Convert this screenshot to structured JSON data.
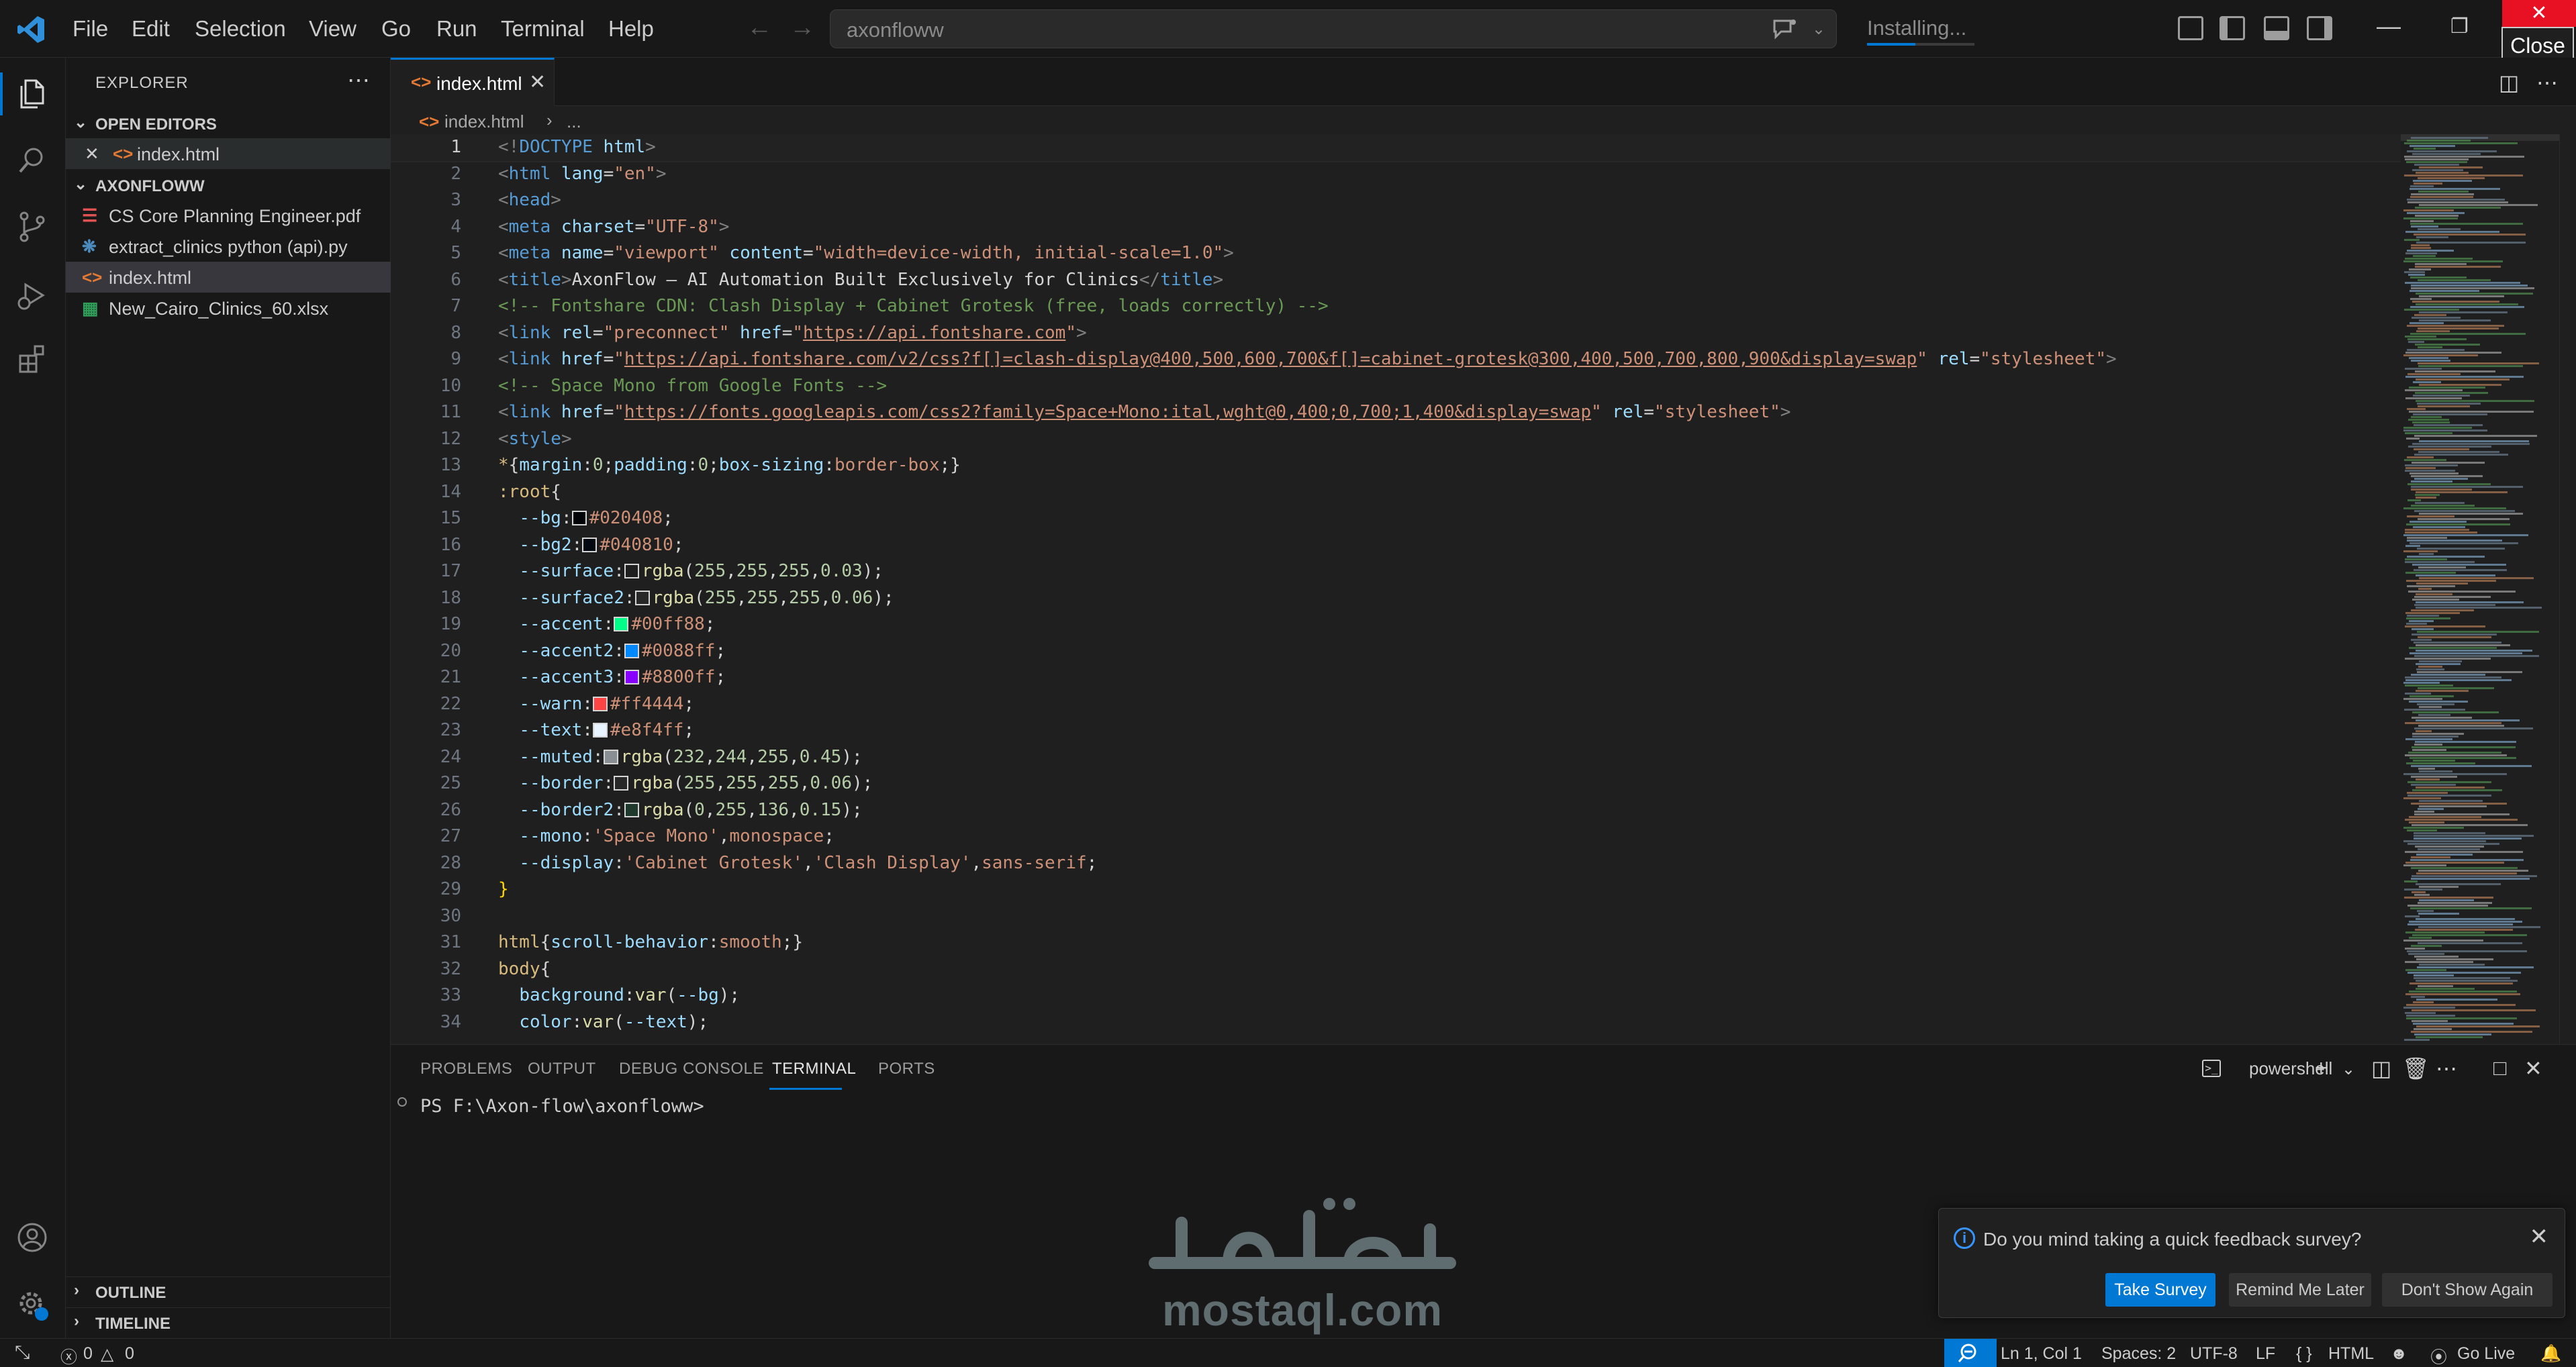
{
  "titlebar": {
    "menu": [
      "File",
      "Edit",
      "Selection",
      "View",
      "Go",
      "Run",
      "Terminal",
      "Help"
    ],
    "search_text": "axonfloww",
    "status_text": "Installing...",
    "install_progress": 0.45,
    "close_tooltip": "Close"
  },
  "sidebar": {
    "title": "EXPLORER",
    "open_editors_label": "OPEN EDITORS",
    "open_editors": [
      {
        "name": "index.html",
        "icon": "html-file-icon"
      }
    ],
    "folder_label": "AXONFLOWW",
    "files": [
      {
        "name": "CS Core Planning Engineer.pdf",
        "icon": "pdf-file-icon"
      },
      {
        "name": "extract_clinics python (api).py",
        "icon": "python-file-icon"
      },
      {
        "name": "index.html",
        "icon": "html-file-icon"
      },
      {
        "name": "New_Cairo_Clinics_60.xlsx",
        "icon": "excel-file-icon"
      }
    ],
    "outline_label": "OUTLINE",
    "timeline_label": "TIMELINE"
  },
  "editor": {
    "tab_label": "index.html",
    "breadcrumb": {
      "file": "index.html",
      "more": "..."
    },
    "current_line": 1,
    "line_numbers": [
      "1",
      "2",
      "3",
      "4",
      "5",
      "6",
      "7",
      "8",
      "9",
      "10",
      "11",
      "12",
      "13",
      "14",
      "15",
      "16",
      "17",
      "18",
      "19",
      "20",
      "21",
      "22",
      "23",
      "24",
      "25",
      "26",
      "27",
      "28",
      "29",
      "30",
      "31",
      "32",
      "33",
      "34"
    ],
    "lines": [
      [
        [
          "tag",
          "<!"
        ],
        [
          "el",
          "DOCTYPE"
        ],
        [
          "at",
          " html"
        ],
        [
          "tag",
          ">"
        ]
      ],
      [
        [
          "tag",
          "<"
        ],
        [
          "el",
          "html"
        ],
        [
          "at",
          " lang"
        ],
        [
          "p",
          "="
        ],
        [
          "st",
          "\"en\""
        ],
        [
          "tag",
          ">"
        ]
      ],
      [
        [
          "tag",
          "<"
        ],
        [
          "el",
          "head"
        ],
        [
          "tag",
          ">"
        ]
      ],
      [
        [
          "tag",
          "<"
        ],
        [
          "el",
          "meta"
        ],
        [
          "at",
          " charset"
        ],
        [
          "p",
          "="
        ],
        [
          "st",
          "\"UTF-8\""
        ],
        [
          "tag",
          ">"
        ]
      ],
      [
        [
          "tag",
          "<"
        ],
        [
          "el",
          "meta"
        ],
        [
          "at",
          " name"
        ],
        [
          "p",
          "="
        ],
        [
          "st",
          "\"viewport\""
        ],
        [
          "at",
          " content"
        ],
        [
          "p",
          "="
        ],
        [
          "st",
          "\"width=device-width, initial-scale=1.0\""
        ],
        [
          "tag",
          ">"
        ]
      ],
      [
        [
          "tag",
          "<"
        ],
        [
          "el",
          "title"
        ],
        [
          "tag",
          ">"
        ],
        [
          "p",
          "AxonFlow — AI Automation Built Exclusively for Clinics"
        ],
        [
          "tag",
          "</"
        ],
        [
          "el",
          "title"
        ],
        [
          "tag",
          ">"
        ]
      ],
      [
        [
          "cm",
          "<!-- Fontshare CDN: Clash Display + Cabinet Grotesk (free, loads correctly) -->"
        ]
      ],
      [
        [
          "tag",
          "<"
        ],
        [
          "el",
          "link"
        ],
        [
          "at",
          " rel"
        ],
        [
          "p",
          "="
        ],
        [
          "st",
          "\"preconnect\""
        ],
        [
          "at",
          " href"
        ],
        [
          "p",
          "="
        ],
        [
          "st",
          "\""
        ],
        [
          "url",
          "https://api.fontshare.com"
        ],
        [
          "st",
          "\""
        ],
        [
          "tag",
          ">"
        ]
      ],
      [
        [
          "tag",
          "<"
        ],
        [
          "el",
          "link"
        ],
        [
          "at",
          " href"
        ],
        [
          "p",
          "="
        ],
        [
          "st",
          "\""
        ],
        [
          "url",
          "https://api.fontshare.com/v2/css?f[]=clash-display@400,500,600,700&f[]=cabinet-grotesk@300,400,500,700,800,900&display=swap"
        ],
        [
          "st",
          "\""
        ],
        [
          "at",
          " rel"
        ],
        [
          "p",
          "="
        ],
        [
          "st",
          "\"stylesheet\""
        ],
        [
          "tag",
          ">"
        ]
      ],
      [
        [
          "cm",
          "<!-- Space Mono from Google Fonts -->"
        ]
      ],
      [
        [
          "tag",
          "<"
        ],
        [
          "el",
          "link"
        ],
        [
          "at",
          " href"
        ],
        [
          "p",
          "="
        ],
        [
          "st",
          "\""
        ],
        [
          "url",
          "https://fonts.googleapis.com/css2?family=Space+Mono:ital,wght@0,400;0,700;1,400&display=swap"
        ],
        [
          "st",
          "\""
        ],
        [
          "at",
          " rel"
        ],
        [
          "p",
          "="
        ],
        [
          "st",
          "\"stylesheet\""
        ],
        [
          "tag",
          ">"
        ]
      ],
      [
        [
          "tag",
          "<"
        ],
        [
          "el",
          "style"
        ],
        [
          "tag",
          ">"
        ]
      ],
      [
        [
          "sel",
          "*"
        ],
        [
          "p",
          "{"
        ],
        [
          "pr",
          "margin"
        ],
        [
          "p",
          ":"
        ],
        [
          "nu",
          "0"
        ],
        [
          "p",
          ";"
        ],
        [
          "pr",
          "padding"
        ],
        [
          "p",
          ":"
        ],
        [
          "nu",
          "0"
        ],
        [
          "p",
          ";"
        ],
        [
          "pr",
          "box-sizing"
        ],
        [
          "p",
          ":"
        ],
        [
          "kw",
          "border-box"
        ],
        [
          "p",
          ";}"
        ]
      ],
      [
        [
          "sel",
          ":root"
        ],
        [
          "p",
          "{"
        ]
      ],
      [
        [
          "p",
          "  "
        ],
        [
          "pr",
          "--bg"
        ],
        [
          "p",
          ":"
        ],
        [
          "sw",
          "#020408"
        ],
        [
          "kw",
          "#020408"
        ],
        [
          "p",
          ";"
        ]
      ],
      [
        [
          "p",
          "  "
        ],
        [
          "pr",
          "--bg2"
        ],
        [
          "p",
          ":"
        ],
        [
          "sw",
          "#040810"
        ],
        [
          "kw",
          "#040810"
        ],
        [
          "p",
          ";"
        ]
      ],
      [
        [
          "p",
          "  "
        ],
        [
          "pr",
          "--surface"
        ],
        [
          "p",
          ":"
        ],
        [
          "sw",
          "#1f1f1f"
        ],
        [
          "fn",
          "rgba"
        ],
        [
          "p",
          "("
        ],
        [
          "nu",
          "255"
        ],
        [
          "p",
          ","
        ],
        [
          "nu",
          "255"
        ],
        [
          "p",
          ","
        ],
        [
          "nu",
          "255"
        ],
        [
          "p",
          ","
        ],
        [
          "nu",
          "0.03"
        ],
        [
          "p",
          ");"
        ]
      ],
      [
        [
          "p",
          "  "
        ],
        [
          "pr",
          "--surface2"
        ],
        [
          "p",
          ":"
        ],
        [
          "sw",
          "#282828"
        ],
        [
          "fn",
          "rgba"
        ],
        [
          "p",
          "("
        ],
        [
          "nu",
          "255"
        ],
        [
          "p",
          ","
        ],
        [
          "nu",
          "255"
        ],
        [
          "p",
          ","
        ],
        [
          "nu",
          "255"
        ],
        [
          "p",
          ","
        ],
        [
          "nu",
          "0.06"
        ],
        [
          "p",
          ");"
        ]
      ],
      [
        [
          "p",
          "  "
        ],
        [
          "pr",
          "--accent"
        ],
        [
          "p",
          ":"
        ],
        [
          "sw",
          "#00ff88"
        ],
        [
          "kw",
          "#00ff88"
        ],
        [
          "p",
          ";"
        ]
      ],
      [
        [
          "p",
          "  "
        ],
        [
          "pr",
          "--accent2"
        ],
        [
          "p",
          ":"
        ],
        [
          "sw",
          "#0088ff"
        ],
        [
          "kw",
          "#0088ff"
        ],
        [
          "p",
          ";"
        ]
      ],
      [
        [
          "p",
          "  "
        ],
        [
          "pr",
          "--accent3"
        ],
        [
          "p",
          ":"
        ],
        [
          "sw",
          "#8800ff"
        ],
        [
          "kw",
          "#8800ff"
        ],
        [
          "p",
          ";"
        ]
      ],
      [
        [
          "p",
          "  "
        ],
        [
          "pr",
          "--warn"
        ],
        [
          "p",
          ":"
        ],
        [
          "sw",
          "#ff4444"
        ],
        [
          "kw",
          "#ff4444"
        ],
        [
          "p",
          ";"
        ]
      ],
      [
        [
          "p",
          "  "
        ],
        [
          "pr",
          "--text"
        ],
        [
          "p",
          ":"
        ],
        [
          "sw",
          "#e8f4ff"
        ],
        [
          "kw",
          "#e8f4ff"
        ],
        [
          "p",
          ";"
        ]
      ],
      [
        [
          "p",
          "  "
        ],
        [
          "pr",
          "--muted"
        ],
        [
          "p",
          ":"
        ],
        [
          "sw",
          "#8a8f94"
        ],
        [
          "fn",
          "rgba"
        ],
        [
          "p",
          "("
        ],
        [
          "nu",
          "232"
        ],
        [
          "p",
          ","
        ],
        [
          "nu",
          "244"
        ],
        [
          "p",
          ","
        ],
        [
          "nu",
          "255"
        ],
        [
          "p",
          ","
        ],
        [
          "nu",
          "0.45"
        ],
        [
          "p",
          ");"
        ]
      ],
      [
        [
          "p",
          "  "
        ],
        [
          "pr",
          "--border"
        ],
        [
          "p",
          ":"
        ],
        [
          "sw",
          "#282828"
        ],
        [
          "fn",
          "rgba"
        ],
        [
          "p",
          "("
        ],
        [
          "nu",
          "255"
        ],
        [
          "p",
          ","
        ],
        [
          "nu",
          "255"
        ],
        [
          "p",
          ","
        ],
        [
          "nu",
          "255"
        ],
        [
          "p",
          ","
        ],
        [
          "nu",
          "0.06"
        ],
        [
          "p",
          ");"
        ]
      ],
      [
        [
          "p",
          "  "
        ],
        [
          "pr",
          "--border2"
        ],
        [
          "p",
          ":"
        ],
        [
          "sw",
          "#1f3a2c"
        ],
        [
          "fn",
          "rgba"
        ],
        [
          "p",
          "("
        ],
        [
          "nu",
          "0"
        ],
        [
          "p",
          ","
        ],
        [
          "nu",
          "255"
        ],
        [
          "p",
          ","
        ],
        [
          "nu",
          "136"
        ],
        [
          "p",
          ","
        ],
        [
          "nu",
          "0.15"
        ],
        [
          "p",
          ");"
        ]
      ],
      [
        [
          "p",
          "  "
        ],
        [
          "pr",
          "--mono"
        ],
        [
          "p",
          ":"
        ],
        [
          "kw",
          "'Space Mono'"
        ],
        [
          "p",
          ","
        ],
        [
          "kw",
          "monospace"
        ],
        [
          "p",
          ";"
        ]
      ],
      [
        [
          "p",
          "  "
        ],
        [
          "pr",
          "--display"
        ],
        [
          "p",
          ":"
        ],
        [
          "kw",
          "'Cabinet Grotesk'"
        ],
        [
          "p",
          ","
        ],
        [
          "kw",
          "'Clash Display'"
        ],
        [
          "p",
          ","
        ],
        [
          "kw",
          "sans-serif"
        ],
        [
          "p",
          ";"
        ]
      ],
      [
        [
          "br",
          "}"
        ]
      ],
      [],
      [
        [
          "sel",
          "html"
        ],
        [
          "p",
          "{"
        ],
        [
          "pr",
          "scroll-behavior"
        ],
        [
          "p",
          ":"
        ],
        [
          "kw",
          "smooth"
        ],
        [
          "p",
          ";}"
        ]
      ],
      [
        [
          "sel",
          "body"
        ],
        [
          "p",
          "{"
        ]
      ],
      [
        [
          "p",
          "  "
        ],
        [
          "pr",
          "background"
        ],
        [
          "p",
          ":"
        ],
        [
          "fn",
          "var"
        ],
        [
          "p",
          "("
        ],
        [
          "pr",
          "--bg"
        ],
        [
          "p",
          ");"
        ]
      ],
      [
        [
          "p",
          "  "
        ],
        [
          "pr",
          "color"
        ],
        [
          "p",
          ":"
        ],
        [
          "fn",
          "var"
        ],
        [
          "p",
          "("
        ],
        [
          "pr",
          "--text"
        ],
        [
          "p",
          ");"
        ]
      ]
    ]
  },
  "panel": {
    "tabs": [
      "PROBLEMS",
      "OUTPUT",
      "DEBUG CONSOLE",
      "TERMINAL",
      "PORTS"
    ],
    "active_tab": "TERMINAL",
    "shell": "powershell",
    "prompt": "PS F:\\Axon-flow\\axonfloww>"
  },
  "watermark": {
    "text": "mostaql.com"
  },
  "notification": {
    "message": "Do you mind taking a quick feedback survey?",
    "buttons": [
      "Take Survey",
      "Remind Me Later",
      "Don't Show Again"
    ]
  },
  "statusbar": {
    "errors": "0",
    "warnings": "0",
    "position": "Ln 1, Col 1",
    "spaces": "Spaces: 2",
    "encoding": "UTF-8",
    "eol": "LF",
    "language": "HTML",
    "golive": "Go Live"
  },
  "colors": {
    "accent": "#0078d4",
    "close": "#e81123"
  }
}
